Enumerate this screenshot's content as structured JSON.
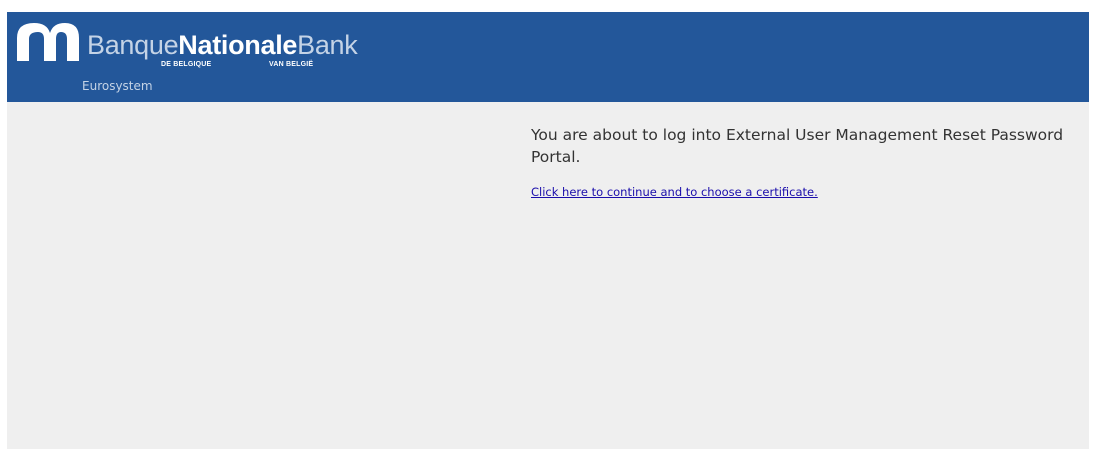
{
  "brand": {
    "color": "#23579a",
    "wordmark": {
      "part1": "Banque",
      "part2": "Nationale",
      "part3": "Bank"
    },
    "sub_fr": "DE BELGIQUE",
    "sub_nl": "VAN BELGIË",
    "eurosystem": "Eurosystem",
    "logo_icon": "nbb-arch-logo-icon"
  },
  "main": {
    "message": "You are about to log into External User Management Reset Password Portal.",
    "link_text": "Click here to continue and to choose a certificate.",
    "link_color": "#1a0dab"
  }
}
